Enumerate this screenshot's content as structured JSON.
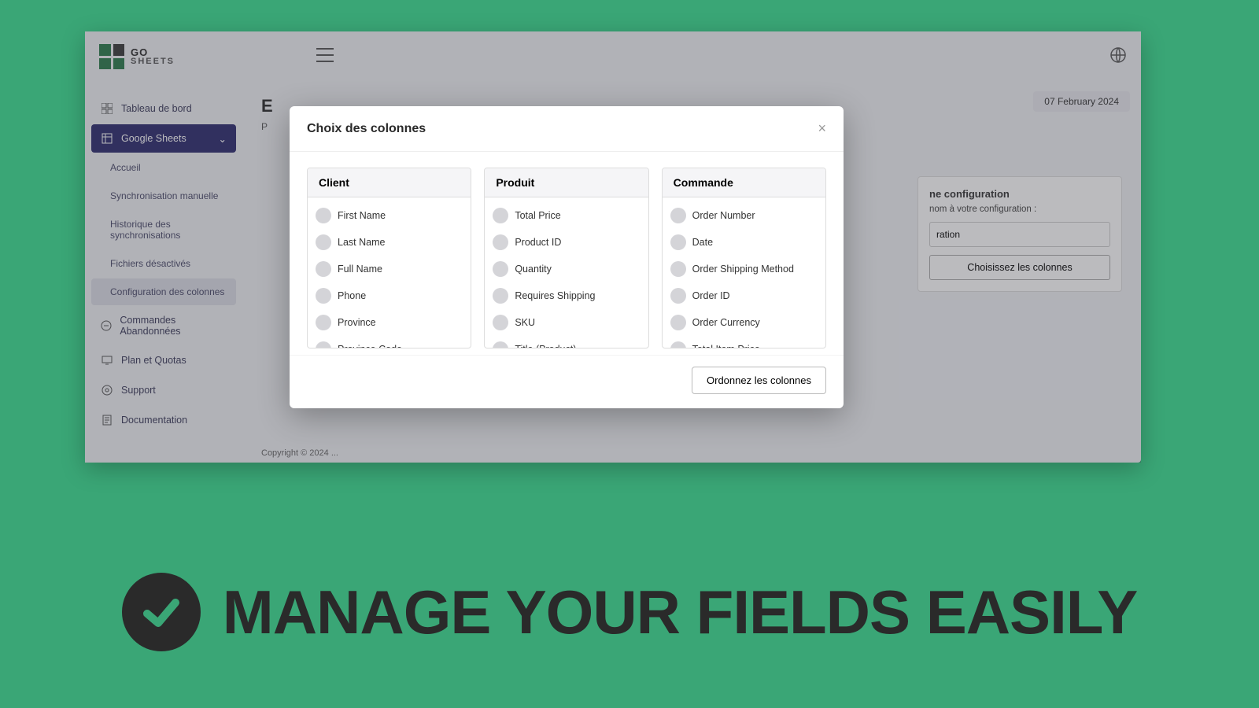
{
  "logo": {
    "top": "GO",
    "bottom": "SHEETS"
  },
  "nav": {
    "dashboard": "Tableau de bord",
    "google_sheets": "Google Sheets",
    "sub": {
      "accueil": "Accueil",
      "sync_manual": "Synchronisation manuelle",
      "history": "Historique des synchronisations",
      "disabled": "Fichiers désactivés",
      "config_cols": "Configuration des colonnes"
    },
    "abandoned": "Commandes Abandonnées",
    "plan": "Plan et Quotas",
    "support": "Support",
    "docs": "Documentation"
  },
  "page": {
    "title_initial": "E",
    "sub_initial": "P",
    "date": "07 February 2024",
    "footer_prefix": "Copyright © 2024 ..."
  },
  "config": {
    "heading_suffix": "ne configuration",
    "desc_suffix": "nom à votre configuration :",
    "input_suffix": "ration",
    "button": "Choisissez les colonnes"
  },
  "modal": {
    "title": "Choix des colonnes",
    "order_btn": "Ordonnez les colonnes",
    "groups": [
      {
        "header": "Client",
        "items": [
          "First Name",
          "Last Name",
          "Full Name",
          "Phone",
          "Province",
          "Province Code"
        ]
      },
      {
        "header": "Produit",
        "items": [
          "Total Price",
          "Product ID",
          "Quantity",
          "Requires Shipping",
          "SKU",
          "Title (Product)"
        ]
      },
      {
        "header": "Commande",
        "items": [
          "Order Number",
          "Date",
          "Order Shipping Method",
          "Order ID",
          "Order Currency",
          "Total Item Price"
        ]
      }
    ]
  },
  "promo": "MANAGE YOUR FIELDS EASILY"
}
